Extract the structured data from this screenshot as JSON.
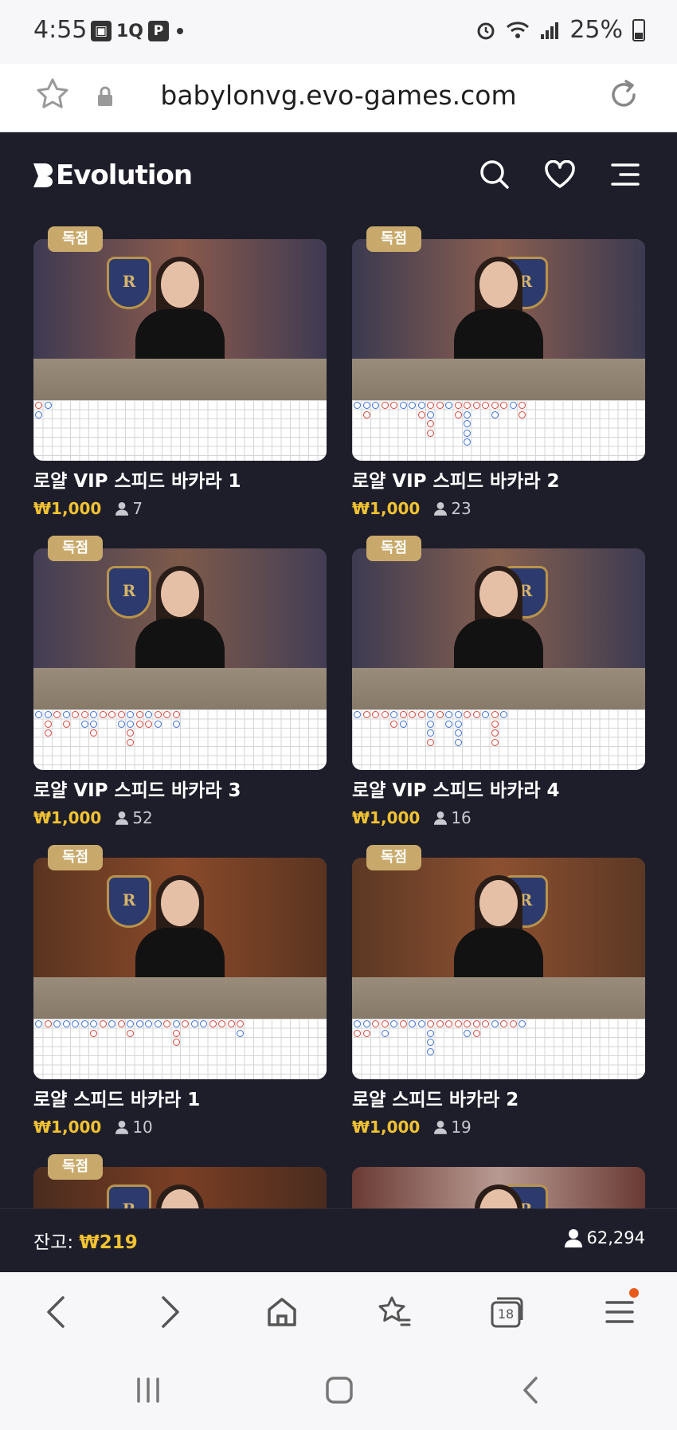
{
  "status_bar": {
    "time": "4:55",
    "left_icons": [
      "gallery-icon",
      "app-1q-icon",
      "parking-p-icon",
      "dot-icon"
    ],
    "battery": "25%"
  },
  "url_bar": {
    "url": "babylonvg.evo-games.com"
  },
  "header": {
    "logo_text": "Evolution"
  },
  "colors": {
    "app_bg": "#1e1e2b",
    "accent_gold": "#f1c232",
    "badge_bg": "#c9a96b",
    "banker_red": "#d9453a",
    "player_blue": "#3a6fd8"
  },
  "tables": [
    {
      "badge": "독점",
      "title": "로얄 VIP 스피드 바카라 1",
      "price": "₩1,000",
      "players": "7"
    },
    {
      "badge": "독점",
      "title": "로얄 VIP 스피드 바카라 2",
      "price": "₩1,000",
      "players": "23"
    },
    {
      "badge": "독점",
      "title": "로얄 VIP 스피드 바카라 3",
      "price": "₩1,000",
      "players": "52"
    },
    {
      "badge": "독점",
      "title": "로얄 VIP 스피드 바카라 4",
      "price": "₩1,000",
      "players": "16"
    },
    {
      "badge": "독점",
      "title": "로얄 스피드 바카라 1",
      "price": "₩1,000",
      "players": "10"
    },
    {
      "badge": "독점",
      "title": "로얄 스피드 바카라 2",
      "price": "₩1,000",
      "players": "19"
    },
    {
      "badge": "독점",
      "title": "",
      "price": "",
      "players": ""
    },
    {
      "badge": "",
      "title": "",
      "price": "",
      "players": ""
    }
  ],
  "footer": {
    "balance_label": "잔고:",
    "balance_value": "₩219",
    "online_count": "62,294"
  },
  "browser_nav": {
    "tab_count": "18"
  }
}
